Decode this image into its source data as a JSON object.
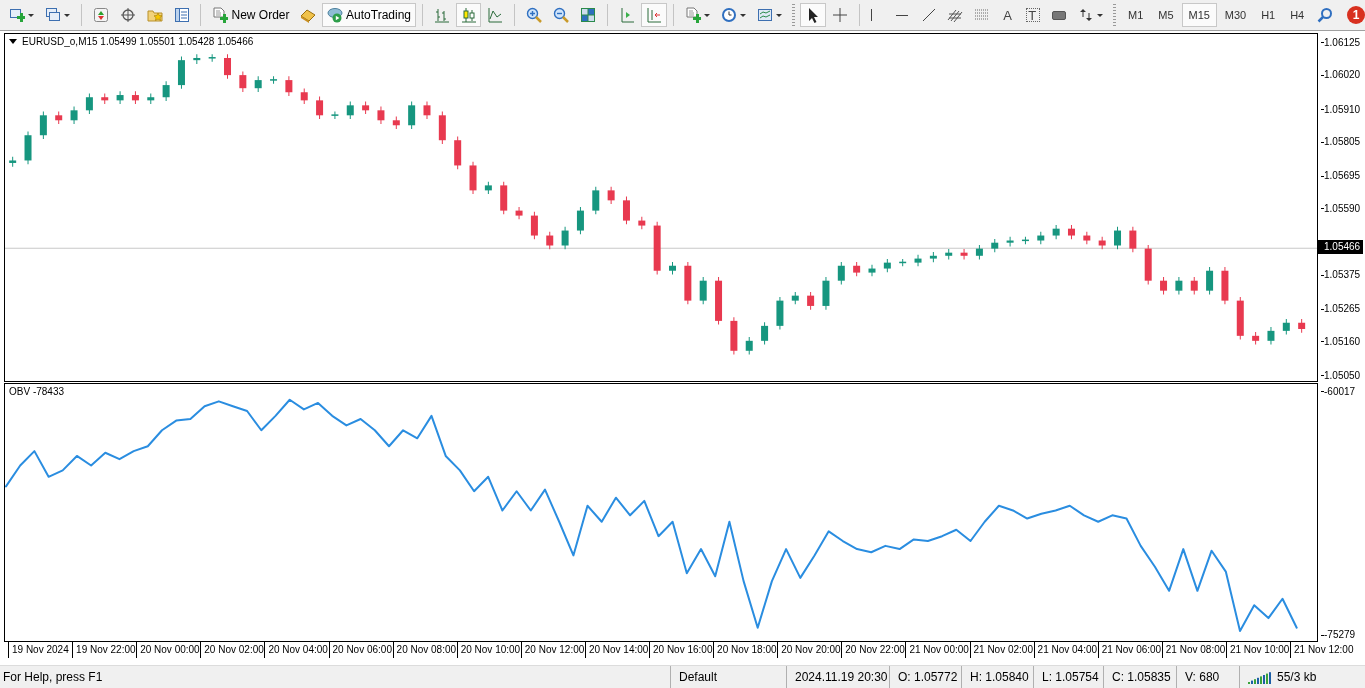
{
  "toolbar": [
    {
      "kind": "tool",
      "dropdown": true,
      "pressed": false
    },
    {
      "kind": "tool",
      "dropdown": true,
      "pressed": false
    },
    {
      "kind": "separator"
    },
    {
      "kind": "tool",
      "dropdown": false,
      "pressed": false
    },
    {
      "kind": "tool",
      "dropdown": false,
      "pressed": false
    },
    {
      "kind": "tool",
      "dropdown": false,
      "pressed": false
    },
    {
      "kind": "tool",
      "dropdown": false,
      "pressed": false
    },
    {
      "kind": "separator"
    },
    {
      "kind": "button",
      "label": "New Order",
      "pressed": false
    },
    {
      "kind": "tool",
      "dropdown": false,
      "pressed": false
    },
    {
      "kind": "button",
      "label": "AutoTrading",
      "pressed": true
    },
    {
      "kind": "separator"
    },
    {
      "kind": "tool",
      "dropdown": false,
      "pressed": false
    },
    {
      "kind": "tool",
      "dropdown": false,
      "pressed": true
    },
    {
      "kind": "tool",
      "dropdown": false,
      "pressed": false
    },
    {
      "kind": "separator"
    },
    {
      "kind": "tool",
      "dropdown": false,
      "pressed": false
    },
    {
      "kind": "tool",
      "dropdown": false,
      "pressed": false
    },
    {
      "kind": "tool",
      "dropdown": false,
      "pressed": false
    },
    {
      "kind": "separator"
    },
    {
      "kind": "tool",
      "dropdown": false,
      "pressed": false
    },
    {
      "kind": "tool",
      "dropdown": false,
      "pressed": true
    },
    {
      "kind": "separator"
    },
    {
      "kind": "tool",
      "dropdown": true,
      "pressed": false
    },
    {
      "kind": "tool",
      "dropdown": true,
      "pressed": false
    },
    {
      "kind": "tool",
      "dropdown": true,
      "pressed": false
    },
    {
      "kind": "gripper"
    },
    {
      "kind": "tool",
      "dropdown": false,
      "pressed": true
    },
    {
      "kind": "tool",
      "dropdown": false,
      "pressed": false
    },
    {
      "kind": "separator"
    },
    {
      "kind": "tool",
      "dropdown": false,
      "pressed": false
    },
    {
      "kind": "tool",
      "dropdown": false,
      "pressed": false
    },
    {
      "kind": "tool",
      "dropdown": false,
      "pressed": false
    },
    {
      "kind": "tool",
      "dropdown": false,
      "pressed": false
    },
    {
      "kind": "tool",
      "dropdown": false,
      "pressed": false
    },
    {
      "kind": "letter",
      "label": "A",
      "framed": false
    },
    {
      "kind": "letter",
      "label": "T",
      "framed": true
    },
    {
      "kind": "tool",
      "dropdown": false,
      "pressed": false
    },
    {
      "kind": "tool",
      "dropdown": true,
      "pressed": false
    },
    {
      "kind": "gripper"
    },
    {
      "kind": "timeframe",
      "label": "M1",
      "selected": false
    },
    {
      "kind": "timeframe",
      "label": "M5",
      "selected": false
    },
    {
      "kind": "timeframe",
      "label": "M15",
      "selected": true
    },
    {
      "kind": "timeframe",
      "label": "M30",
      "selected": false
    },
    {
      "kind": "timeframe",
      "label": "H1",
      "selected": false
    },
    {
      "kind": "timeframe",
      "label": "H4",
      "selected": false
    },
    {
      "kind": "tool",
      "dropdown": false,
      "pressed": false
    },
    {
      "kind": "notification",
      "count": "1"
    }
  ],
  "price_pane": {
    "title": "EURUSD_o,M15  1.05499 1.05501 1.05428 1.05466",
    "chart_data": {
      "type": "candlestick",
      "ylim": [
        1.0504,
        1.06154
      ],
      "yticks": [
        {
          "value": 1.06125,
          "label": "1.06125"
        },
        {
          "value": 1.0602,
          "label": "1.06020"
        },
        {
          "value": 1.0591,
          "label": "1.05910"
        },
        {
          "value": 1.05805,
          "label": "1.05805"
        },
        {
          "value": 1.05695,
          "label": "1.05695"
        },
        {
          "value": 1.0559,
          "label": "1.05590"
        },
        {
          "value": 1.05375,
          "label": "1.05375"
        },
        {
          "value": 1.05265,
          "label": "1.05265"
        },
        {
          "value": 1.0516,
          "label": "1.05160"
        },
        {
          "value": 1.0505,
          "label": "1.05050"
        }
      ],
      "series": [
        {
          "color": "#16967f",
          "ohlc": [
            [
              1.0574,
              1.0576,
              1.05728,
              1.05748
            ],
            [
              1.05748,
              1.05841,
              1.05736,
              1.05829
            ],
            [
              1.05829,
              1.05905,
              1.05817,
              1.05893
            ],
            null,
            [
              1.05877,
              1.05921,
              1.05865,
              1.05909
            ],
            [
              1.05909,
              1.05963,
              1.05897,
              1.05951
            ],
            null,
            [
              1.05941,
              1.0597,
              1.05929,
              1.05958
            ],
            null,
            [
              1.05941,
              1.05963,
              1.05929,
              1.05951
            ],
            [
              1.05951,
              1.06002,
              1.05939,
              1.0599
            ],
            [
              1.0599,
              1.06082,
              1.05978,
              1.0607
            ],
            [
              1.0607,
              1.06089,
              1.06058,
              1.06077
            ],
            [
              1.06077,
              1.06089,
              1.06065,
              1.0608
            ],
            null,
            null,
            [
              1.0598,
              1.06018,
              1.05968,
              1.06006
            ],
            [
              1.06006,
              1.06018,
              1.05994,
              1.06009
            ],
            null,
            null,
            null,
            [
              1.05893,
              1.05905,
              1.05881,
              1.05896
            ],
            [
              1.05893,
              1.05937,
              1.05881,
              1.05925
            ],
            null,
            null,
            null,
            [
              1.05861,
              1.05937,
              1.05849,
              1.05925
            ],
            null,
            null,
            null,
            null,
            [
              1.05652,
              1.0568,
              1.0564,
              1.05668
            ],
            null,
            null,
            null,
            null,
            [
              1.05475,
              1.05535,
              1.05463,
              1.05523
            ],
            [
              1.05523,
              1.05599,
              1.05511,
              1.05587
            ],
            [
              1.05587,
              1.05664,
              1.05575,
              1.05652
            ],
            null,
            null,
            null,
            null,
            [
              1.05394,
              1.05422,
              1.05382,
              1.0541
            ],
            null,
            [
              1.05298,
              1.05374,
              1.05286,
              1.05362
            ],
            null,
            null,
            [
              1.05137,
              1.05181,
              1.05125,
              1.05169
            ],
            [
              1.05169,
              1.05229,
              1.05157,
              1.05217
            ],
            [
              1.05217,
              1.0531,
              1.05205,
              1.05298
            ],
            [
              1.05298,
              1.05326,
              1.05286,
              1.05314
            ],
            null,
            [
              1.05281,
              1.05374,
              1.05269,
              1.05362
            ],
            [
              1.05362,
              1.05422,
              1.0535,
              1.0541
            ],
            null,
            [
              1.05388,
              1.05413,
              1.05376,
              1.05401
            ],
            [
              1.05401,
              1.05432,
              1.05389,
              1.0542
            ],
            [
              1.0542,
              1.05432,
              1.05408,
              1.05423
            ],
            [
              1.0542,
              1.05445,
              1.05408,
              1.05433
            ],
            [
              1.05433,
              1.05454,
              1.05421,
              1.05442
            ],
            [
              1.05442,
              1.05464,
              1.0543,
              1.05452
            ],
            null,
            [
              1.05442,
              1.05477,
              1.0543,
              1.05465
            ],
            [
              1.05465,
              1.05496,
              1.05453,
              1.05484
            ],
            [
              1.05484,
              1.05503,
              1.05472,
              1.05491
            ],
            [
              1.05491,
              1.05503,
              1.05479,
              1.05494
            ],
            [
              1.05491,
              1.05519,
              1.05479,
              1.05507
            ],
            [
              1.05507,
              1.05541,
              1.05495,
              1.05529
            ],
            null,
            null,
            null,
            [
              1.05475,
              1.05535,
              1.05463,
              1.05523
            ],
            null,
            null,
            null,
            [
              1.0533,
              1.05374,
              1.05318,
              1.05362
            ],
            null,
            [
              1.0533,
              1.05406,
              1.05318,
              1.05394
            ],
            null,
            null,
            null,
            [
              1.05169,
              1.05213,
              1.05157,
              1.05201
            ],
            [
              1.05201,
              1.05239,
              1.05189,
              1.05227
            ],
            null
          ]
        },
        {
          "color": "#e8394f",
          "ohlc": [
            null,
            null,
            null,
            [
              1.05893,
              1.05905,
              1.05865,
              1.05877
            ],
            null,
            null,
            [
              1.05951,
              1.05963,
              1.05929,
              1.05941
            ],
            null,
            [
              1.05958,
              1.0597,
              1.05929,
              1.05941
            ],
            null,
            null,
            null,
            null,
            null,
            [
              1.06077,
              1.06089,
              1.0601,
              1.06022
            ],
            [
              1.06022,
              1.06034,
              1.05968,
              1.0598
            ],
            null,
            null,
            [
              1.06006,
              1.06018,
              1.05955,
              1.05967
            ],
            [
              1.05967,
              1.05979,
              1.05929,
              1.05941
            ],
            [
              1.05941,
              1.05953,
              1.05881,
              1.05893
            ],
            null,
            null,
            [
              1.05925,
              1.05937,
              1.05897,
              1.05909
            ],
            [
              1.05909,
              1.05921,
              1.05865,
              1.05877
            ],
            [
              1.05877,
              1.05889,
              1.05849,
              1.05861
            ],
            null,
            [
              1.05925,
              1.05937,
              1.05881,
              1.05893
            ],
            [
              1.05893,
              1.05905,
              1.05801,
              1.05813
            ],
            [
              1.05813,
              1.05825,
              1.0572,
              1.05732
            ],
            [
              1.05732,
              1.05744,
              1.0564,
              1.05652
            ],
            null,
            [
              1.05668,
              1.0568,
              1.05575,
              1.05587
            ],
            [
              1.05587,
              1.05599,
              1.05559,
              1.05571
            ],
            [
              1.05571,
              1.05583,
              1.05495,
              1.05507
            ],
            [
              1.05507,
              1.05519,
              1.05463,
              1.05475
            ],
            null,
            null,
            null,
            [
              1.05652,
              1.05664,
              1.05608,
              1.0562
            ],
            [
              1.0562,
              1.05632,
              1.05543,
              1.05555
            ],
            [
              1.05555,
              1.05567,
              1.05527,
              1.05539
            ],
            [
              1.05539,
              1.05551,
              1.05382,
              1.05394
            ],
            null,
            [
              1.0541,
              1.05422,
              1.05286,
              1.05298
            ],
            null,
            [
              1.05362,
              1.05374,
              1.05221,
              1.05233
            ],
            [
              1.05233,
              1.05245,
              1.05125,
              1.05137
            ],
            null,
            null,
            null,
            null,
            [
              1.05314,
              1.05326,
              1.05269,
              1.05281
            ],
            null,
            null,
            [
              1.0541,
              1.05422,
              1.05376,
              1.05388
            ],
            null,
            null,
            null,
            null,
            null,
            null,
            [
              1.05452,
              1.05464,
              1.0543,
              1.05442
            ],
            null,
            null,
            null,
            null,
            null,
            null,
            [
              1.05529,
              1.05541,
              1.05495,
              1.05507
            ],
            [
              1.05507,
              1.05519,
              1.05479,
              1.05491
            ],
            [
              1.05491,
              1.05503,
              1.05463,
              1.05475
            ],
            null,
            [
              1.05523,
              1.05535,
              1.05453,
              1.05465
            ],
            [
              1.05465,
              1.05477,
              1.0535,
              1.05362
            ],
            [
              1.05362,
              1.05374,
              1.05318,
              1.0533
            ],
            null,
            [
              1.05362,
              1.05374,
              1.05318,
              1.0533
            ],
            null,
            [
              1.05394,
              1.05406,
              1.05286,
              1.05298
            ],
            [
              1.05298,
              1.0531,
              1.05173,
              1.05185
            ],
            [
              1.05185,
              1.05197,
              1.05157,
              1.05169
            ],
            null,
            null,
            [
              1.05227,
              1.05239,
              1.05195,
              1.05207
            ]
          ]
        }
      ],
      "ref_lines": [
        {
          "axis": "y",
          "value": 1.05466,
          "label": "1.05466"
        }
      ]
    }
  },
  "obv_pane": {
    "title": "OBV -78433",
    "chart_data": {
      "type": "line",
      "ylim": [
        -75528,
        -59519
      ],
      "yticks": [
        {
          "value": -60017,
          "label": "-60017"
        },
        {
          "value": -75279,
          "label": "-75279"
        }
      ],
      "series": [
        {
          "color": "#2a8de0",
          "values": [
            -65900,
            -64600,
            -63700,
            -65300,
            -64900,
            -64000,
            -64600,
            -63800,
            -64200,
            -63700,
            -63400,
            -62400,
            -61800,
            -61700,
            -60900,
            -60600,
            -60900,
            -61200,
            -62400,
            -61500,
            -60500,
            -61100,
            -60700,
            -61500,
            -62100,
            -61700,
            -62400,
            -63400,
            -62400,
            -62900,
            -61500,
            -64000,
            -64900,
            -66200,
            -65300,
            -67400,
            -66200,
            -67400,
            -66100,
            -68100,
            -70200,
            -67100,
            -68100,
            -66600,
            -67700,
            -66800,
            -69000,
            -68100,
            -71300,
            -69800,
            -71500,
            -68100,
            -71800,
            -74700,
            -71800,
            -69800,
            -71600,
            -70200,
            -68700,
            -69300,
            -69800,
            -70000,
            -69600,
            -69800,
            -69200,
            -69300,
            -69000,
            -68600,
            -69300,
            -68100,
            -67100,
            -67400,
            -67900,
            -67600,
            -67400,
            -67100,
            -67700,
            -68100,
            -67700,
            -67900,
            -69600,
            -70900,
            -72400,
            -69800,
            -72400,
            -69900,
            -71200,
            -74900,
            -73300,
            -74100,
            -72900,
            -74700
          ]
        }
      ]
    }
  },
  "time_axis": [
    "19 Nov 2024",
    "19 Nov 22:00",
    "20 Nov 00:00",
    "20 Nov 02:00",
    "20 Nov 04:00",
    "20 Nov 06:00",
    "20 Nov 08:00",
    "20 Nov 10:00",
    "20 Nov 12:00",
    "20 Nov 14:00",
    "20 Nov 16:00",
    "20 Nov 18:00",
    "20 Nov 20:00",
    "20 Nov 22:00",
    "21 Nov 00:00",
    "21 Nov 02:00",
    "21 Nov 04:00",
    "21 Nov 06:00",
    "21 Nov 08:00",
    "21 Nov 10:00",
    "21 Nov 12:00"
  ],
  "status_bar": {
    "help": "For Help, press F1",
    "profile": "Default",
    "bar_time": "2024.11.19 20:30",
    "open": "O: 1.05772",
    "high": "H: 1.05840",
    "low": "L: 1.05754",
    "close": "C: 1.05835",
    "volume": "V: 680",
    "traffic": "55/3 kb"
  }
}
